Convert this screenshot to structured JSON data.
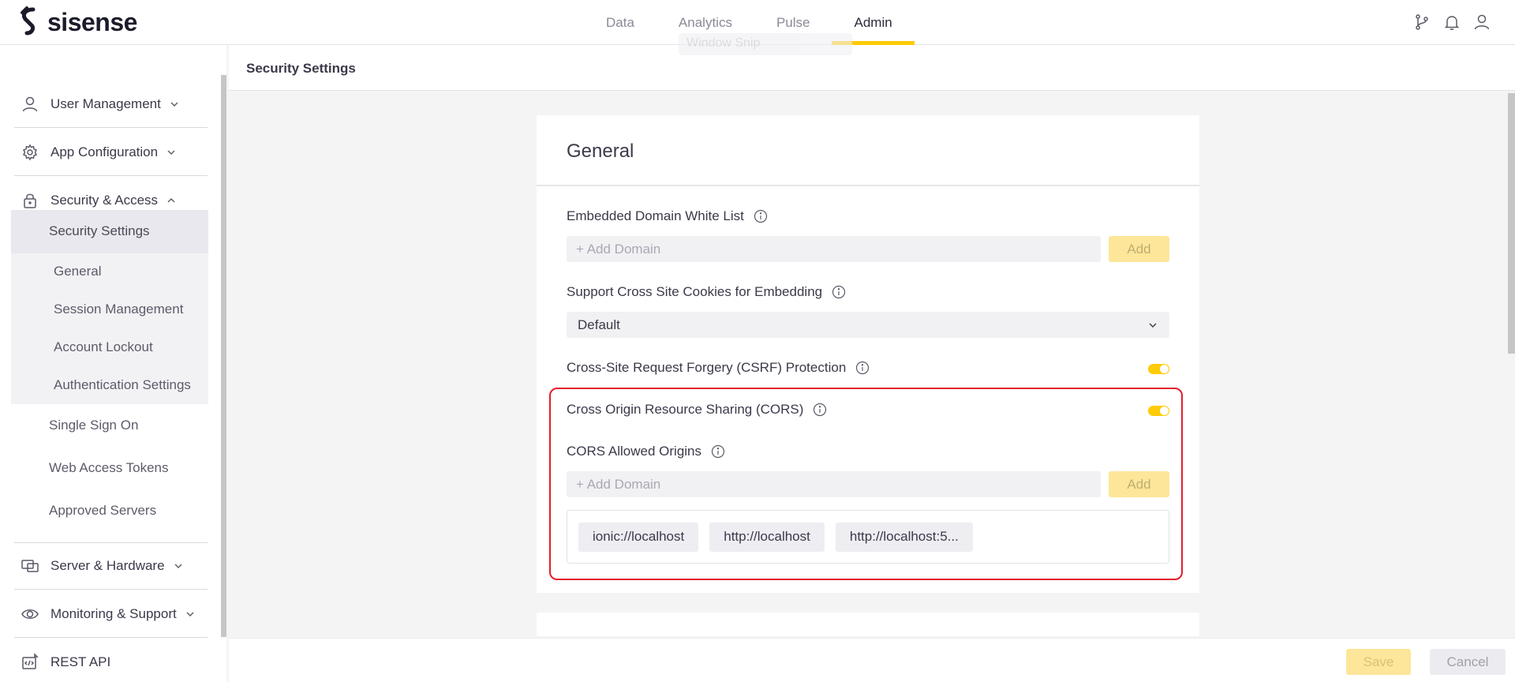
{
  "app": {
    "logo_text": "sisense",
    "nav_tabs": [
      {
        "label": "Data"
      },
      {
        "label": "Analytics"
      },
      {
        "label": "Pulse"
      },
      {
        "label": "Admin"
      }
    ],
    "active_tab": "Admin",
    "icons": [
      "git-branch-icon",
      "bell-icon",
      "user-icon"
    ]
  },
  "sidebar": {
    "groups": [
      {
        "label": "User Management",
        "icon": "user-icon"
      },
      {
        "label": "App Configuration",
        "icon": "gear-icon"
      },
      {
        "label": "Security & Access",
        "icon": "lock-icon"
      }
    ],
    "security_items": {
      "head": "Security Settings",
      "nested": [
        "General",
        "Session Management",
        "Account Lockout",
        "Authentication Settings"
      ],
      "flat": [
        "Single Sign On",
        "Web Access Tokens",
        "Approved Servers"
      ]
    },
    "bottom_groups": [
      {
        "label": "Server & Hardware",
        "icon": "server-icon"
      },
      {
        "label": "Monitoring & Support",
        "icon": "eye-icon"
      },
      {
        "label": "REST API",
        "icon": "api-icon"
      }
    ]
  },
  "page": {
    "title": "Security Settings",
    "ghost_overlay": "Window Snip"
  },
  "card": {
    "title": "General",
    "embedded_domain": {
      "label": "Embedded Domain White List",
      "placeholder": "+ Add Domain",
      "add_label": "Add"
    },
    "cross_site_cookies": {
      "label": "Support Cross Site Cookies for Embedding",
      "selected": "Default"
    },
    "csrf": {
      "label": "Cross-Site Request Forgery (CSRF) Protection",
      "enabled": true
    },
    "cors": {
      "label": "Cross Origin Resource Sharing (CORS)",
      "enabled": true,
      "origins_label": "CORS Allowed Origins",
      "placeholder": "+ Add Domain",
      "add_label": "Add",
      "origins": [
        "ionic://localhost",
        "http://localhost",
        "http://localhost:5..."
      ]
    }
  },
  "footer": {
    "save_label": "Save",
    "cancel_label": "Cancel"
  },
  "colors": {
    "accent": "#ffcb05",
    "highlight_border": "#e31e2c"
  }
}
